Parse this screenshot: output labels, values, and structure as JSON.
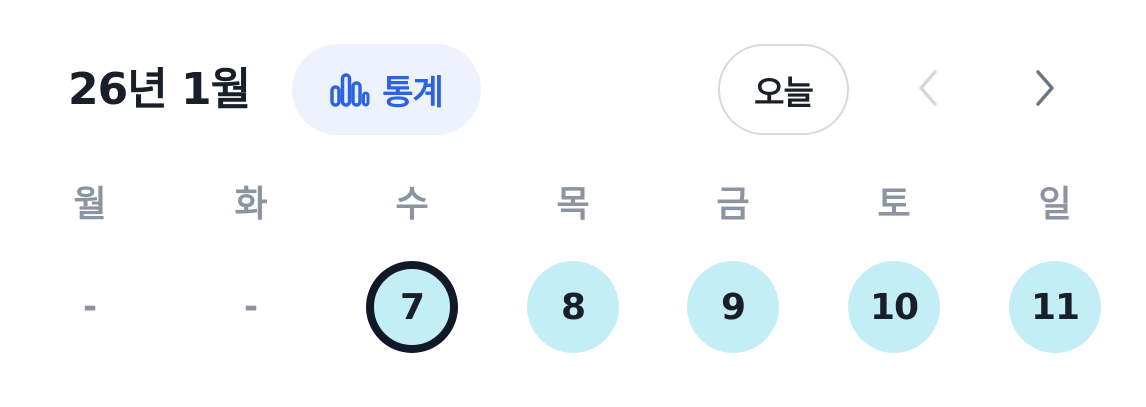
{
  "header": {
    "month_title": "26년 1월",
    "stats_label": "통계",
    "today_label": "오늘",
    "prev_icon": "chevron-left-icon",
    "next_icon": "chevron-right-icon"
  },
  "colors": {
    "stats_bg": "#edf2fd",
    "accent": "#2d63e2",
    "day_circle": "#c4eef5",
    "selected_ring": "#111827",
    "weekday_text": "#8b95a1"
  },
  "weekdays": [
    "월",
    "화",
    "수",
    "목",
    "금",
    "토",
    "일"
  ],
  "days": [
    {
      "label": "-",
      "type": "empty"
    },
    {
      "label": "-",
      "type": "empty"
    },
    {
      "label": "7",
      "type": "day",
      "selected": true
    },
    {
      "label": "8",
      "type": "day",
      "selected": false
    },
    {
      "label": "9",
      "type": "day",
      "selected": false
    },
    {
      "label": "10",
      "type": "day",
      "selected": false
    },
    {
      "label": "11",
      "type": "day",
      "selected": false
    }
  ]
}
